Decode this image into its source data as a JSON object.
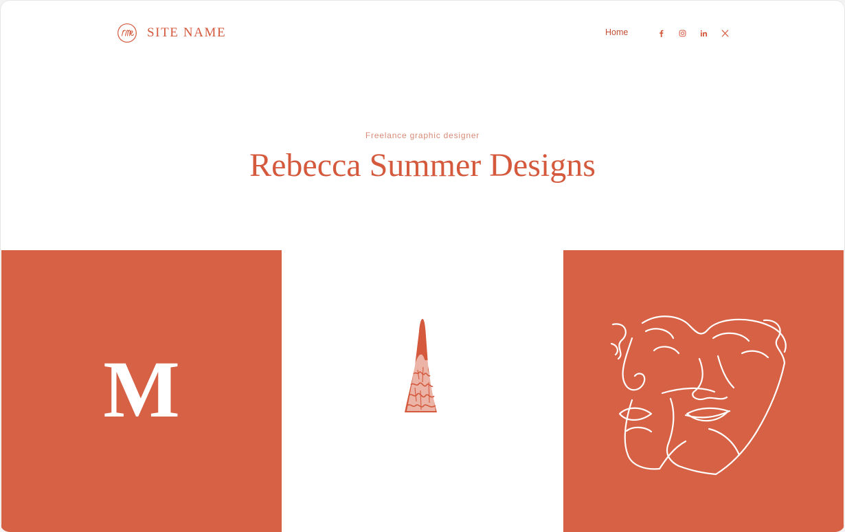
{
  "header": {
    "logo_icon": "script-monogram-circle-icon",
    "site_name": "SITE NAME",
    "nav": [
      {
        "label": "Home"
      }
    ],
    "social": [
      {
        "name": "facebook-icon"
      },
      {
        "name": "instagram-icon"
      },
      {
        "name": "linkedin-icon"
      },
      {
        "name": "x-twitter-icon"
      }
    ]
  },
  "hero": {
    "tagline": "Freelance graphic designer",
    "title": "Rebecca Summer Designs"
  },
  "tiles": [
    {
      "name": "monogram-tile",
      "letter": "M"
    },
    {
      "name": "cone-illustration-tile"
    },
    {
      "name": "line-art-faces-tile"
    }
  ],
  "colors": {
    "accent": "#d4593d",
    "tile_background": "#d66144",
    "page_background": "#ffffff"
  }
}
